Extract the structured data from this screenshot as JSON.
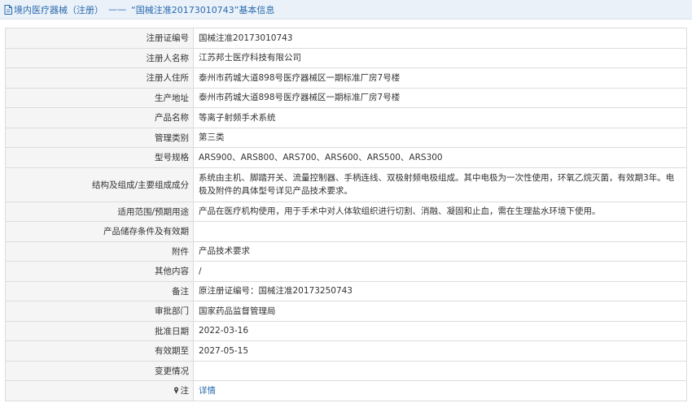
{
  "header": {
    "section": "境内医疗器械（注册）",
    "dash": "——",
    "title": "“国械注准20173010743”基本信息"
  },
  "rows": [
    {
      "label": "注册证编号",
      "value": "国械注准20173010743"
    },
    {
      "label": "注册人名称",
      "value": "江苏邦士医疗科技有限公司"
    },
    {
      "label": "注册人住所",
      "value": "泰州市药城大道898号医疗器械区一期标准厂房7号楼"
    },
    {
      "label": "生产地址",
      "value": "泰州市药城大道898号医疗器械区一期标准厂房7号楼"
    },
    {
      "label": "产品名称",
      "value": "等离子射频手术系统"
    },
    {
      "label": "管理类别",
      "value": "第三类"
    },
    {
      "label": "型号规格",
      "value": "ARS900、ARS800、ARS700、ARS600、ARS500、ARS300"
    },
    {
      "label": "结构及组成/主要组成成分",
      "value": "系统由主机、脚踏开关、流量控制器、手柄连线、双极射频电极组成。其中电极为一次性使用，环氧乙烷灭菌，有效期3年。电极及附件的具体型号详见产品技术要求。"
    },
    {
      "label": "适用范围/预期用途",
      "value": "产品在医疗机构使用，用于手术中对人体软组织进行切割、消融、凝固和止血，需在生理盐水环境下使用。"
    },
    {
      "label": "产品储存条件及有效期",
      "value": ""
    },
    {
      "label": "附件",
      "value": "产品技术要求"
    },
    {
      "label": "其他内容",
      "value": "/"
    },
    {
      "label": "备注",
      "value": "原注册证编号：国械注准20173250743"
    },
    {
      "label": "审批部门",
      "value": "国家药品监督管理局"
    },
    {
      "label": "批准日期",
      "value": "2022-03-16"
    },
    {
      "label": "有效期至",
      "value": "2027-05-15"
    },
    {
      "label": "变更情况",
      "value": ""
    }
  ],
  "note": {
    "label": "注",
    "link": "详情"
  }
}
